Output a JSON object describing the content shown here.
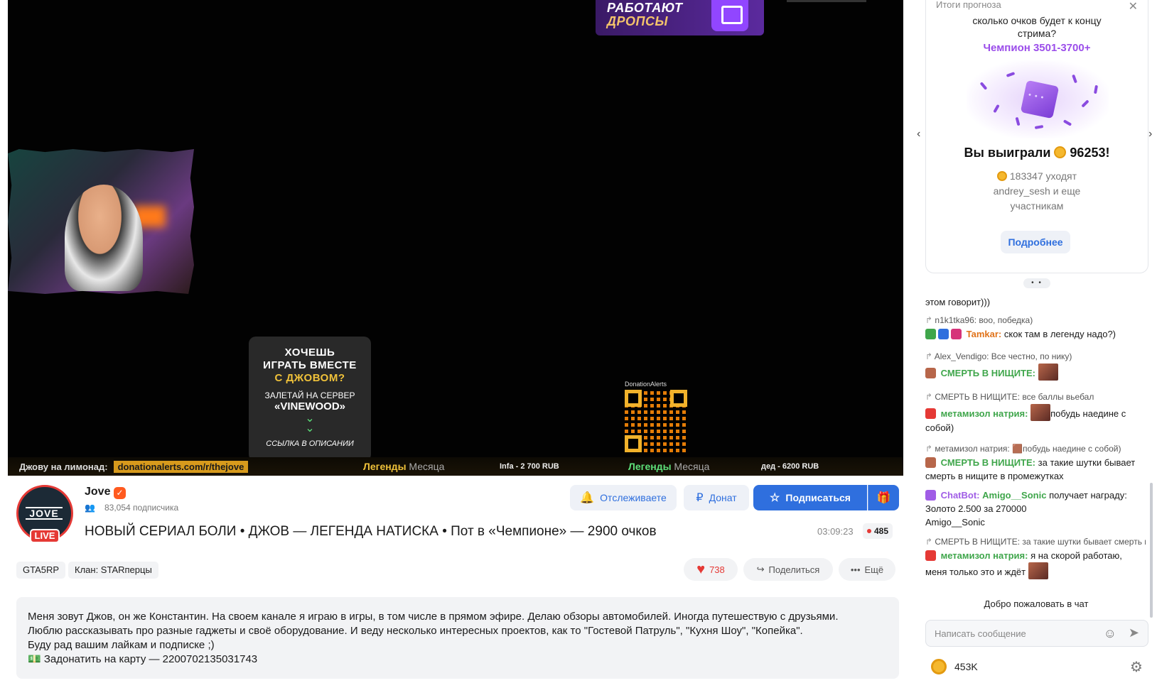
{
  "video": {
    "drops_line1": "РАБОТАЮТ",
    "drops_line2": "ДРОПСЫ",
    "promo": {
      "line1": "ХОЧЕШЬ",
      "line2": "ИГРАТЬ ВМЕСТЕ",
      "line3": "С ДЖОВОМ?",
      "line4": "ЗАЛЕТАЙ НА СЕРВЕР",
      "line5": "«VINEWOOD»",
      "line6": "ССЫЛКА В ОПИСАНИИ"
    },
    "qr_label": "DonationAlerts",
    "ticker": {
      "label": "Джову на лимонад:",
      "link": "donationalerts.com/r/thejove",
      "legends_a": "Легенды",
      "legends_b": "Месяца",
      "amount1": "Infa - 2 700 RUB",
      "amount2": "дед - 6200 RUB"
    }
  },
  "channel": {
    "avatar_text": "JOVE",
    "live_label": "LIVE",
    "name": "Jove",
    "verified_icon": "check-icon",
    "subscribers": "83,054 подписчика",
    "stream_title": "НОВЫЙ СЕРИАЛ БОЛИ • ДЖОВ — ЛЕГЕНДА НАТИСКА • Пот в «Чемпионе» — 2900 очков",
    "duration": "03:09:23",
    "viewers": "485"
  },
  "actions": {
    "follow_label": "Отслеживаете",
    "donate_label": "Донат",
    "subscribe_label": "Подписаться",
    "likes": "738",
    "share_label": "Поделиться",
    "more_label": "Ещё"
  },
  "tags": [
    "GTA5RP",
    "Клан: STARперцы"
  ],
  "description": {
    "line1": "Меня зовут Джов, он же Константин. На своем канале я играю в игры, в том числе в прямом эфире. Делаю обзоры автомобилей. Иногда путешествую с друзьями.",
    "line2": "Люблю рассказывать про разные гаджеты и своё оборудование. И веду несколько интересных проектов, как то \"Гостевой Патруль\", \"Кухня Шоу\", \"Копейка\".",
    "line3": "Буду рад вашим лайкам и подписке ;)",
    "line4": "💵 Задонатить на карту — 2200702135031743"
  },
  "prediction": {
    "header": "Итоги прогноза",
    "question_line1": "сколько очков будет к концу",
    "question_line2": "стрима?",
    "answer": "Чемпион 3501-3700+",
    "won_label": "Вы выиграли",
    "won_amount": "96253!",
    "info_line1": "183347 уходят",
    "info_line2": "andrey_sesh и еще",
    "info_line3": "участникам",
    "more_label": "Подробнее",
    "pager": "• •"
  },
  "chat": {
    "m0_text": "этом говорит)))",
    "m1_reply": "n1k1tka96: воо, победка)",
    "m1_nick": "Tamkar:",
    "m1_text": "скок там в легенду надо?)",
    "m2_reply": "Alex_Vendigo: Все честно, по нику)",
    "m2_nick": "СМЕРТЬ В НИЩИТЕ:",
    "m3_reply": "СМЕРТЬ В НИЩИТЕ: все баллы вьебал",
    "m3_nick": "метамизол натрия:",
    "m3_text_a": "побудь наедине с",
    "m3_text_b": "собой)",
    "m4_reply": "метамизол натрия: 🟫побудь наедине с собой)",
    "m4_nick": "СМЕРТЬ В НИЩИТЕ:",
    "m4_text": "за такие шутки бывает смерть в нищите в промежутках",
    "m5_nick": "ChatBot:",
    "m5_user": "Amigo__Sonic",
    "m5_text": "получает награду: Золото 2.500 за 270000",
    "m5_text2": "Amigo__Sonic",
    "m6_reply": "СМЕРТЬ В НИЩИТЕ: за такие шутки бывает смерть в нищите в промежутках",
    "m6_nick": "метамизол натрия:",
    "m6_text": "я на скорой работаю, меня только это и ждёт",
    "welcome": "Добро пожаловать в чат",
    "input_placeholder": "Написать сообщение",
    "points": "453K"
  }
}
